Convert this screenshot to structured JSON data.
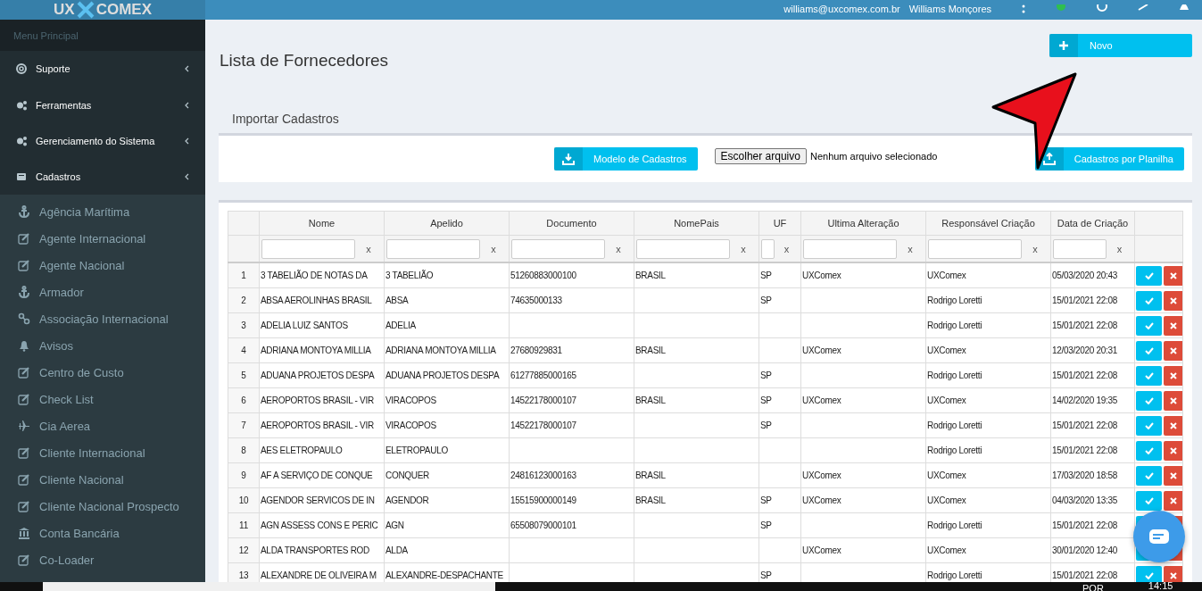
{
  "header": {
    "logo_left": "UX",
    "logo_right": "COMEX",
    "user_email": "williams@uxcomex.com.br",
    "user_name": "Williams Monçores"
  },
  "sidebar": {
    "heading": "Menu Principal",
    "items": [
      {
        "label": "Suporte"
      },
      {
        "label": "Ferramentas"
      },
      {
        "label": "Gerenciamento do Sistema"
      },
      {
        "label": "Cadastros"
      }
    ],
    "subitems": [
      {
        "label": "Agência Marítima"
      },
      {
        "label": "Agente Internacional"
      },
      {
        "label": "Agente Nacional"
      },
      {
        "label": "Armador"
      },
      {
        "label": "Associação Internacional"
      },
      {
        "label": "Avisos"
      },
      {
        "label": "Centro de Custo"
      },
      {
        "label": "Check List"
      },
      {
        "label": "Cia Aerea"
      },
      {
        "label": "Cliente Internacional"
      },
      {
        "label": "Cliente Nacional"
      },
      {
        "label": "Cliente Nacional Prospecto"
      },
      {
        "label": "Conta Bancária"
      },
      {
        "label": "Co-Loader"
      }
    ]
  },
  "page": {
    "title": "Lista de Fornecedores",
    "new_button": "Novo"
  },
  "import": {
    "tab": "Importar Cadastros",
    "template_button": "Modelo de Cadastros",
    "file_button": "Escolher arquivo",
    "file_status": "Nenhum arquivo selecionado",
    "upload_button": "Cadastros por Planilha"
  },
  "table": {
    "columns": [
      "",
      "Nome",
      "Apelido",
      "Documento",
      "NomePais",
      "UF",
      "Ultima Alteração",
      "Responsável Criação",
      "Data de Criação",
      ""
    ],
    "filters": [
      {
        "clear": "x"
      },
      {
        "clear": "x"
      },
      {
        "clear": "x"
      },
      {
        "clear": "x"
      },
      {
        "clear": "x"
      },
      {
        "clear": "x"
      },
      {
        "clear": "x"
      },
      {
        "clear": "x"
      }
    ],
    "rows": [
      [
        "1",
        "3 TABELIÃO DE NOTAS DA",
        "3 TABELIÃO",
        "51260883000100",
        "BRASIL",
        "SP",
        "UXComex",
        "UXComex",
        "05/03/2020 20:43"
      ],
      [
        "2",
        "ABSA AEROLINHAS BRASIL",
        "ABSA",
        "74635000133",
        "",
        "SP",
        "",
        "Rodrigo Loretti",
        "15/01/2021 22:08"
      ],
      [
        "3",
        "ADELIA LUIZ SANTOS",
        "ADELIA",
        "",
        "",
        "",
        "",
        "Rodrigo Loretti",
        "15/01/2021 22:08"
      ],
      [
        "4",
        "ADRIANA MONTOYA MILLIA",
        "ADRIANA MONTOYA MILLIA",
        "27680929831",
        "BRASIL",
        "",
        "UXComex",
        "UXComex",
        "12/03/2020 20:31"
      ],
      [
        "5",
        "ADUANA PROJETOS DESPA",
        "ADUANA PROJETOS DESPA",
        "61277885000165",
        "",
        "SP",
        "",
        "Rodrigo Loretti",
        "15/01/2021 22:08"
      ],
      [
        "6",
        "AEROPORTOS BRASIL - VIR",
        "VIRACOPOS",
        "14522178000107",
        "BRASIL",
        "SP",
        "UXComex",
        "UXComex",
        "14/02/2020 19:35"
      ],
      [
        "7",
        "AEROPORTOS BRASIL - VIR",
        "VIRACOPOS",
        "14522178000107",
        "",
        "SP",
        "",
        "Rodrigo Loretti",
        "15/01/2021 22:08"
      ],
      [
        "8",
        "AES ELETROPAULO",
        "ELETROPAULO",
        "",
        "",
        "",
        "",
        "Rodrigo Loretti",
        "15/01/2021 22:08"
      ],
      [
        "9",
        "AF A SERVIÇO DE CONQUE",
        "CONQUER",
        "24816123000163",
        "BRASIL",
        "",
        "UXComex",
        "UXComex",
        "17/03/2020 18:58"
      ],
      [
        "10",
        "AGENDOR SERVICOS DE IN",
        "AGENDOR",
        "15515900000149",
        "BRASIL",
        "SP",
        "UXComex",
        "UXComex",
        "04/03/2020 13:35"
      ],
      [
        "11",
        "AGN ASSESS CONS E PERIC",
        "AGN",
        "65508079000101",
        "",
        "SP",
        "",
        "Rodrigo Loretti",
        "15/01/2021 22:08"
      ],
      [
        "12",
        "ALDA TRANSPORTES ROD",
        "ALDA",
        "",
        "",
        "",
        "UXComex",
        "UXComex",
        "30/01/2020 12:40"
      ],
      [
        "13",
        "ALEXANDRE DE OLIVEIRA M",
        "ALEXANDRE-DESPACHANTE",
        "",
        "",
        "SP",
        "",
        "Rodrigo Loretti",
        "15/01/2021 22:08"
      ]
    ]
  },
  "taskbar": {
    "language": "POR",
    "time": "14:15"
  }
}
